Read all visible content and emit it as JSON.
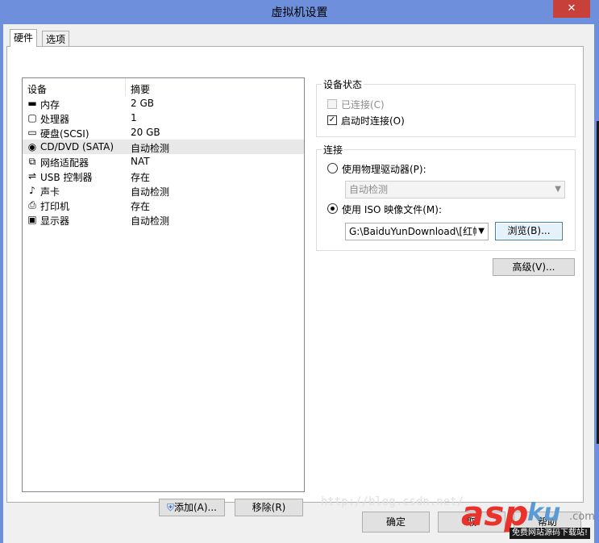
{
  "window": {
    "title": "虚拟机设置",
    "close_glyph": "✕"
  },
  "tabs": [
    {
      "label": "硬件"
    },
    {
      "label": "选项"
    }
  ],
  "device_list": {
    "headers": {
      "device": "设备",
      "summary": "摘要"
    },
    "rows": [
      {
        "icon": "memory-icon",
        "glyph": "▬",
        "name": "内存",
        "summary": "2 GB"
      },
      {
        "icon": "processor-icon",
        "glyph": "▢",
        "name": "处理器",
        "summary": "1"
      },
      {
        "icon": "hard-disk-icon",
        "glyph": "▭",
        "name": "硬盘(SCSI)",
        "summary": "20 GB"
      },
      {
        "icon": "cd-dvd-icon",
        "glyph": "◉",
        "name": "CD/DVD (SATA)",
        "summary": "自动检测"
      },
      {
        "icon": "network-adapter-icon",
        "glyph": "⧉",
        "name": "网络适配器",
        "summary": "NAT"
      },
      {
        "icon": "usb-icon",
        "glyph": "⇌",
        "name": "USB 控制器",
        "summary": "存在"
      },
      {
        "icon": "sound-card-icon",
        "glyph": "♪",
        "name": "声卡",
        "summary": "自动检测"
      },
      {
        "icon": "printer-icon",
        "glyph": "⎙",
        "name": "打印机",
        "summary": "存在"
      },
      {
        "icon": "display-icon",
        "glyph": "▣",
        "name": "显示器",
        "summary": "自动检测"
      }
    ],
    "selected_index": 3
  },
  "list_buttons": {
    "add": "添加(A)...",
    "remove": "移除(R)"
  },
  "device_status": {
    "legend": "设备状态",
    "connected": {
      "label": "已连接(C)",
      "checked": false,
      "disabled": true
    },
    "connect_at_power_on": {
      "label": "启动时连接(O)",
      "checked": true
    }
  },
  "connection": {
    "legend": "连接",
    "physical_drive": {
      "label": "使用物理驱动器(P):",
      "selected": false,
      "value": "自动检测"
    },
    "iso_image": {
      "label": "使用 ISO 映像文件(M):",
      "selected": true,
      "value": "G:\\BaiduYunDownload\\[红帽"
    },
    "browse": "浏览(B)..."
  },
  "advanced_button": "高级(V)...",
  "footer": {
    "ok": "确定",
    "watermark": "http://blog.csdn.net/",
    "cancel_partial": "取",
    "help_partial": "帮助"
  },
  "site_logo": {
    "asp": "asp",
    "ku": "ku",
    "com": ".com",
    "slogan": "免费网站源码下载站!"
  },
  "colors": {
    "titlebar": "#6d8fdc",
    "close": "#c7403a",
    "logo_red": "#e8322b",
    "logo_blue": "#5b9bd5"
  }
}
